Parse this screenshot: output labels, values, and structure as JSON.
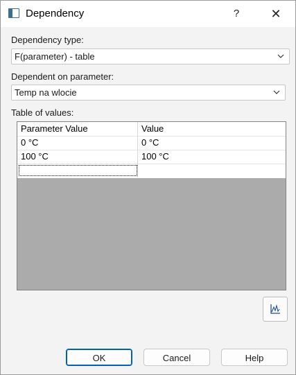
{
  "window": {
    "title": "Dependency",
    "help_glyph": "?",
    "close_glyph": "✕"
  },
  "dependency_type": {
    "label": "Dependency type:",
    "value": "F(parameter) - table"
  },
  "dependent_on": {
    "label": "Dependent on parameter:",
    "value": "Temp na wlocie"
  },
  "table": {
    "label": "Table of values:",
    "headers": [
      "Parameter Value",
      "Value"
    ],
    "rows": [
      [
        "0 °C",
        "0 °C"
      ],
      [
        "100 °C",
        "100 °C"
      ]
    ]
  },
  "chart_button": {
    "icon": "chart-icon"
  },
  "buttons": {
    "ok": "OK",
    "cancel": "Cancel",
    "help": "Help"
  }
}
